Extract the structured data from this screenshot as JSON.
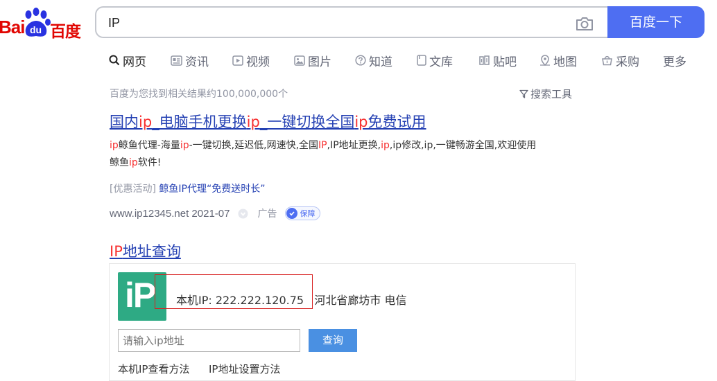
{
  "logo": {
    "text_latin": "Bai",
    "text_paw": "du",
    "text_cn": "百度"
  },
  "search": {
    "value": "IP",
    "button_label": "百度一下"
  },
  "tabs": [
    {
      "label": "网页",
      "icon": "search-icon"
    },
    {
      "label": "资讯",
      "icon": "news-icon"
    },
    {
      "label": "视频",
      "icon": "video-icon"
    },
    {
      "label": "图片",
      "icon": "image-icon"
    },
    {
      "label": "知道",
      "icon": "question-icon"
    },
    {
      "label": "文库",
      "icon": "doc-icon"
    },
    {
      "label": "贴吧",
      "icon": "tieba-icon"
    },
    {
      "label": "地图",
      "icon": "map-pin-icon"
    },
    {
      "label": "采购",
      "icon": "basket-icon"
    },
    {
      "label": "更多",
      "icon": ""
    }
  ],
  "result_count": "百度为您找到相关结果约100,000,000个",
  "search_tools": "搜索工具",
  "result1": {
    "title_parts": [
      "国内",
      "ip",
      "_电脑手机更换",
      "ip",
      "_一键切换全国",
      "ip",
      "免费试用"
    ],
    "desc_line1_parts": [
      "ip",
      "鲸鱼代理-海量",
      "ip",
      "-一键切换,延迟低,网速快,全国",
      "IP",
      ",IP地址更换,",
      "ip",
      ",ip修改,ip,一键畅游全国,欢迎使用"
    ],
    "desc_line2_parts": [
      "鲸鱼",
      "ip",
      "软件!"
    ],
    "promo_prefix": "[优惠活动]",
    "promo_link": "鲸鱼IP代理“免费送时长”",
    "url": "www.ip12345.net",
    "date": "2021-07",
    "ad_label": "广告",
    "badge": "保障"
  },
  "result2": {
    "title_hl": "IP",
    "title_rest": "地址查询",
    "logo_text": "iP",
    "ip_label": "本机IP:",
    "ip_value": "222.222.120.75",
    "location": "河北省廊坊市 电信",
    "input_placeholder": "请输入ip地址",
    "query_button": "查询",
    "link1": "本机IP查看方法",
    "link2": "IP地址设置方法"
  },
  "colors": {
    "brand_red": "#e10602",
    "paw_blue": "#2932e1",
    "button_blue": "#4e6ef2",
    "link_blue": "#2440b3",
    "highlight_red": "#f73131",
    "ip_logo_green": "#2eaa84"
  }
}
